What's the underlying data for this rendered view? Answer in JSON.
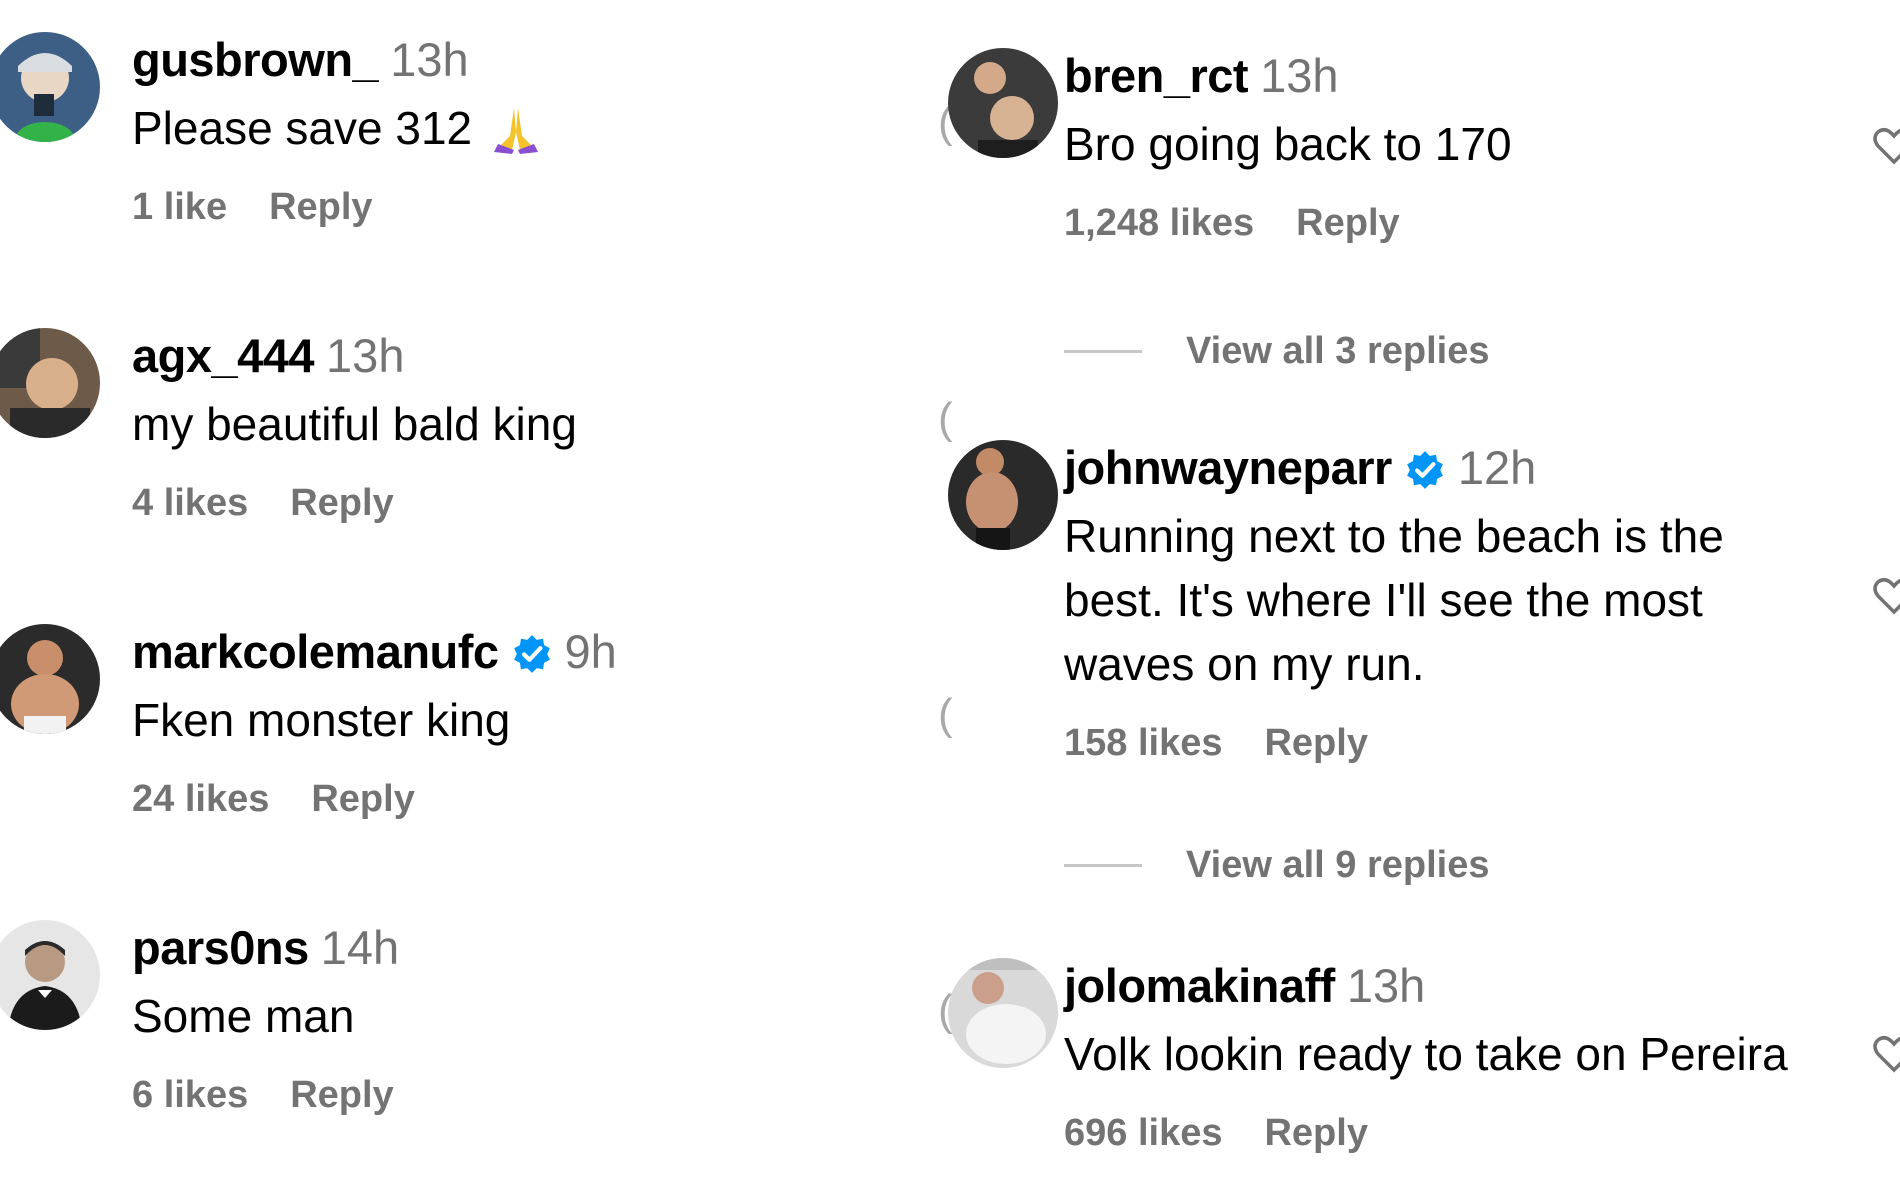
{
  "left_comments": [
    {
      "username": "gusbrown_",
      "time": "13h",
      "text": "Please save 312",
      "likes": "1 like",
      "reply": "Reply",
      "verified": false,
      "emoji": "folded-hands"
    },
    {
      "username": "agx_444",
      "time": "13h",
      "text": "my beautiful bald king",
      "likes": "4 likes",
      "reply": "Reply",
      "verified": false
    },
    {
      "username": "markcolemanufc",
      "time": "9h",
      "text": "Fken monster king",
      "likes": "24 likes",
      "reply": "Reply",
      "verified": true
    },
    {
      "username": "pars0ns",
      "time": "14h",
      "text": "Some man",
      "likes": "6 likes",
      "reply": "Reply",
      "verified": false
    }
  ],
  "right_comments": [
    {
      "username": "bren_rct",
      "time": "13h",
      "text": "Bro going back to 170",
      "likes": "1,248 likes",
      "reply": "Reply",
      "verified": false,
      "view_replies": "View all 3 replies"
    },
    {
      "username": "johnwayneparr",
      "time": "12h",
      "text_lines": [
        "Running next to the beach is the",
        "best. It's where I'll see the most",
        "waves on my run."
      ],
      "likes": "158 likes",
      "reply": "Reply",
      "verified": true,
      "view_replies": "View all 9 replies"
    },
    {
      "username": "jolomakinaff",
      "time": "13h",
      "text": "Volk lookin ready to take on Pereira",
      "likes": "696 likes",
      "reply": "Reply",
      "verified": false
    }
  ],
  "colors": {
    "muted": "#737373",
    "verified_blue": "#0095f6",
    "divider": "#c7c7c7"
  },
  "icons": [
    "heart-icon",
    "verified-badge-icon",
    "folded-hands-emoji"
  ]
}
